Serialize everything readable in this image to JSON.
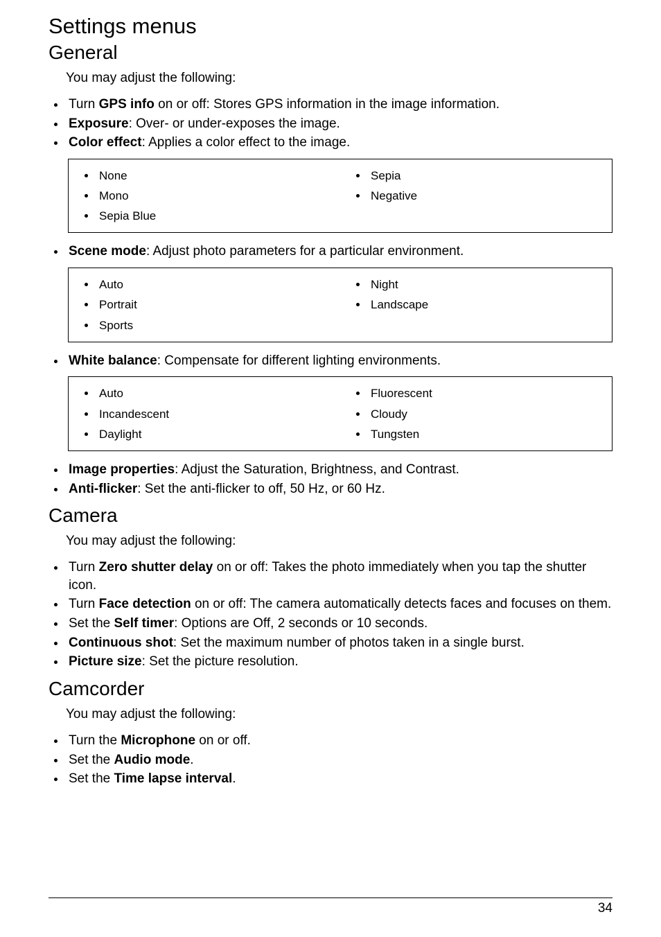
{
  "title": "Settings menus",
  "sections": {
    "general": {
      "heading": "General",
      "intro": "You may adjust the following:",
      "gps_prefix": "Turn ",
      "gps_bold": "GPS info",
      "gps_suffix": " on or off: Stores GPS information in the image information.",
      "exposure_bold": "Exposure",
      "exposure_suffix": ": Over- or under-exposes the image.",
      "color_bold": "Color effect",
      "color_suffix": ": Applies a color effect to the image.",
      "color_box": {
        "left": [
          "None",
          "Mono",
          "Sepia Blue"
        ],
        "right": [
          "Sepia",
          "Negative"
        ]
      },
      "scene_bold": "Scene mode",
      "scene_suffix": ": Adjust photo parameters for a particular environment.",
      "scene_box": {
        "left": [
          "Auto",
          "Portrait",
          "Sports"
        ],
        "right": [
          "Night",
          "Landscape"
        ]
      },
      "wb_bold": "White balance",
      "wb_suffix": ": Compensate for different lighting environments.",
      "wb_box": {
        "left": [
          "Auto",
          "Incandescent",
          "Daylight"
        ],
        "right": [
          "Fluorescent",
          "Cloudy",
          "Tungsten"
        ]
      },
      "img_bold": "Image properties",
      "img_suffix": ": Adjust the Saturation, Brightness, and Contrast.",
      "af_bold": "Anti-flicker",
      "af_suffix": ": Set the anti-flicker to off, 50 Hz, or 60 Hz."
    },
    "camera": {
      "heading": "Camera",
      "intro": "You may adjust the following:",
      "zsd_prefix": "Turn ",
      "zsd_bold": "Zero shutter delay",
      "zsd_suffix": " on or off: Takes the photo immediately when you tap the shutter icon.",
      "fd_prefix": "Turn ",
      "fd_bold": "Face detection",
      "fd_suffix": " on or off: The camera automatically detects faces and focuses on them.",
      "st_prefix": "Set the ",
      "st_bold": "Self timer",
      "st_suffix": ": Options are Off, 2 seconds or 10 seconds.",
      "cs_bold": "Continuous shot",
      "cs_suffix": ": Set the maximum number of photos taken in a single burst.",
      "ps_bold": "Picture size",
      "ps_suffix": ": Set the picture resolution."
    },
    "camcorder": {
      "heading": "Camcorder",
      "intro": "You may adjust the following:",
      "mic_prefix": "Turn the ",
      "mic_bold": "Microphone",
      "mic_suffix": " on or off.",
      "am_prefix": "Set the ",
      "am_bold": "Audio mode",
      "am_suffix": ".",
      "tli_prefix": "Set the ",
      "tli_bold": "Time lapse interval",
      "tli_suffix": "."
    }
  },
  "page_number": "34"
}
